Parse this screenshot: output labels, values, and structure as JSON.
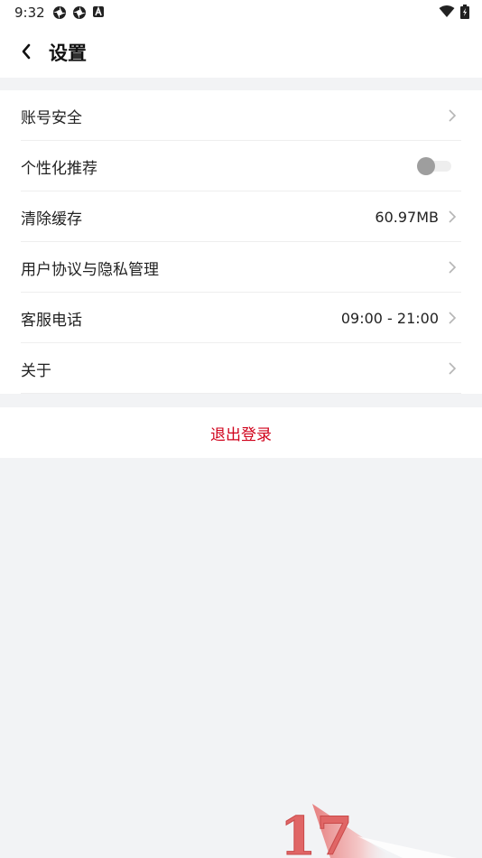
{
  "status_bar": {
    "time": "9:32",
    "left_icons": [
      "aperture-icon",
      "aperture-icon",
      "a-box-icon"
    ],
    "right_icons": [
      "wifi-icon",
      "battery-charging-icon"
    ]
  },
  "header": {
    "back_icon": "chevron-left-icon",
    "title": "设置"
  },
  "settings": {
    "items": [
      {
        "label": "账号安全",
        "value": "",
        "type": "link"
      },
      {
        "label": "个性化推荐",
        "value": "",
        "type": "toggle",
        "toggle_on": false
      },
      {
        "label": "清除缓存",
        "value": "60.97MB",
        "type": "link"
      },
      {
        "label": "用户协议与隐私管理",
        "value": "",
        "type": "link"
      },
      {
        "label": "客服电话",
        "value": "09:00 - 21:00",
        "type": "link"
      },
      {
        "label": "关于",
        "value": "",
        "type": "link"
      }
    ]
  },
  "logout": {
    "label": "退出登录",
    "color": "#d0021b"
  },
  "watermark": {
    "text": "17"
  },
  "colors": {
    "background": "#f2f3f5",
    "card": "#ffffff",
    "accent_red": "#d0021b",
    "toggle_off_knob": "#9e9e9e"
  }
}
